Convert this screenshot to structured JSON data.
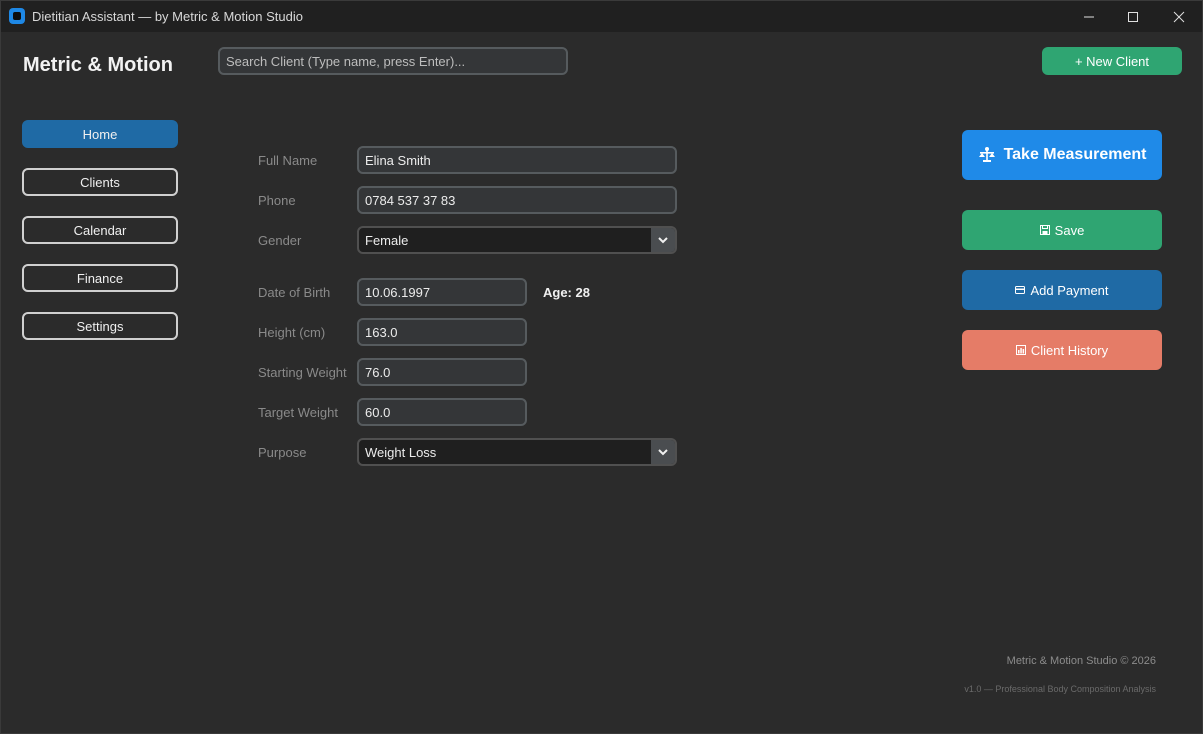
{
  "window": {
    "title": "Dietitian Assistant — by Metric & Motion Studio"
  },
  "header": {
    "brand": "Metric & Motion",
    "search_placeholder": "Search Client (Type name, press Enter)...",
    "new_client_label": "+ New Client"
  },
  "sidebar": {
    "items": [
      {
        "label": "Home",
        "active": true
      },
      {
        "label": "Clients",
        "active": false
      },
      {
        "label": "Calendar",
        "active": false
      },
      {
        "label": "Finance",
        "active": false
      },
      {
        "label": "Settings",
        "active": false
      }
    ]
  },
  "form": {
    "full_name": {
      "label": "Full Name",
      "value": "Elina Smith"
    },
    "phone": {
      "label": "Phone",
      "value": "0784 537 37 83"
    },
    "gender": {
      "label": "Gender",
      "value": "Female"
    },
    "dob": {
      "label": "Date of Birth",
      "value": "10.06.1997"
    },
    "age_text": "Age: 28",
    "height": {
      "label": "Height (cm)",
      "value": "163.0"
    },
    "starting_weight": {
      "label": "Starting Weight",
      "value": "76.0"
    },
    "target_weight": {
      "label": "Target Weight",
      "value": "60.0"
    },
    "purpose": {
      "label": "Purpose",
      "value": "Weight Loss"
    }
  },
  "actions": {
    "take_measurement": "Take Measurement",
    "save": "Save",
    "add_payment": "Add Payment",
    "client_history": "Client History"
  },
  "footer": {
    "copyright": "Metric & Motion Studio © 2026",
    "version": "v1.0 — Professional Body Composition Analysis"
  },
  "colors": {
    "accent_blue": "#1f6aa5",
    "measure_blue": "#1f8ae8",
    "green": "#2fa572",
    "salmon": "#e57c67",
    "background": "#2b2b2b"
  }
}
